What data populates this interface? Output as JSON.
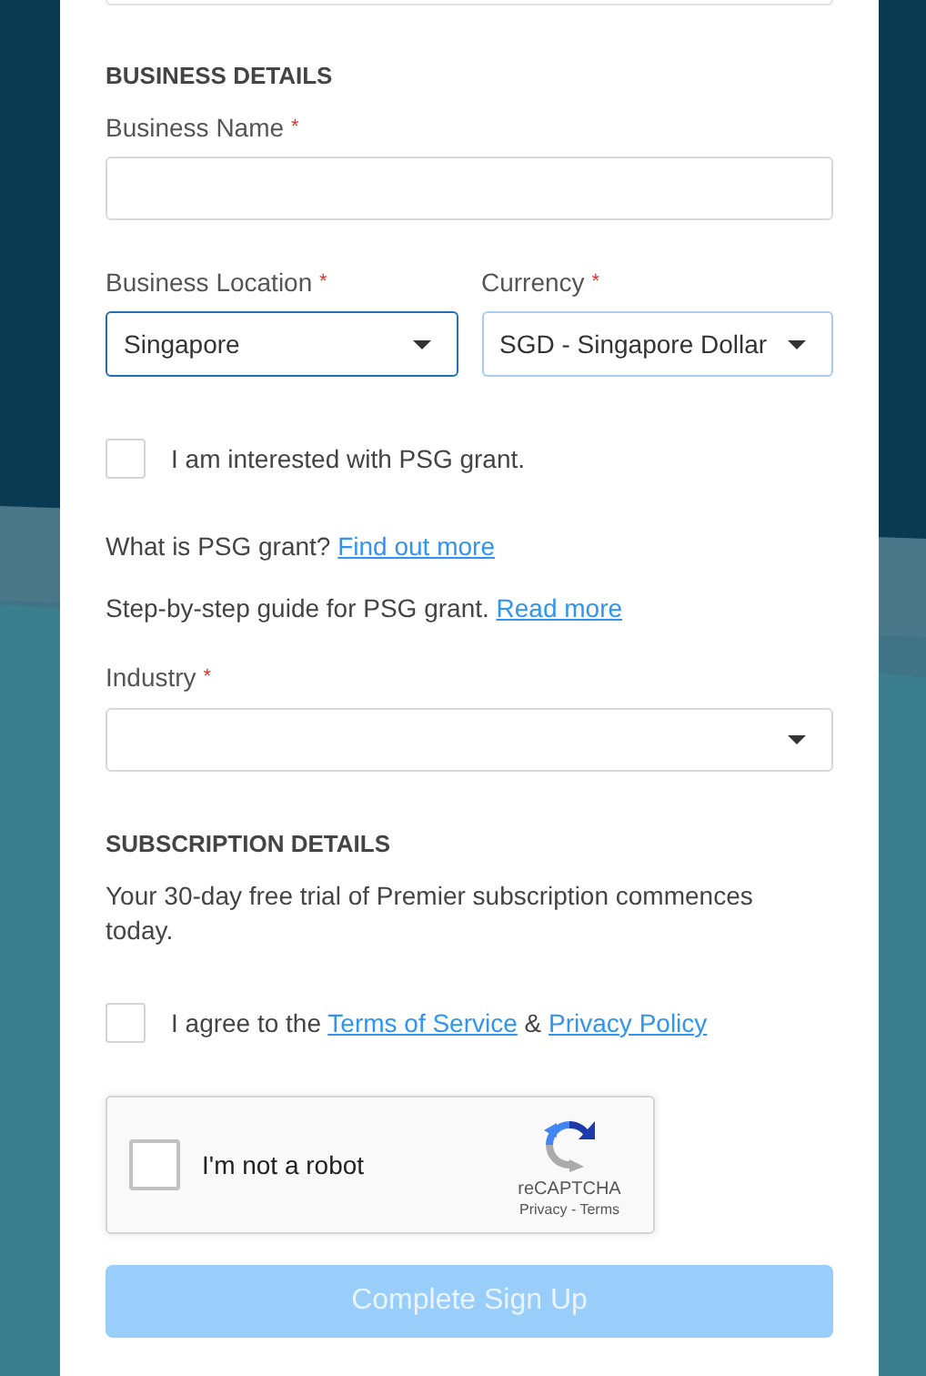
{
  "business_details": {
    "heading": "BUSINESS DETAILS",
    "business_name": {
      "label": "Business Name",
      "required_mark": "*"
    },
    "business_location": {
      "label": "Business Location",
      "required_mark": "*",
      "value": "Singapore",
      "focused": true
    },
    "currency": {
      "label": "Currency",
      "required_mark": "*",
      "value": "SGD - Singapore Dollar",
      "focused": false,
      "hovered": true
    },
    "psg_checkbox": {
      "label": "I am interested with PSG grant.",
      "checked": false
    },
    "info_lines": [
      {
        "parts": [
          {
            "kind": "text",
            "text": "What is PSG grant?"
          },
          {
            "kind": "link",
            "text": "Find out more"
          }
        ]
      },
      {
        "parts": [
          {
            "kind": "text",
            "text": "Step-by-step guide for PSG grant."
          },
          {
            "kind": "link",
            "text": "Read more"
          }
        ]
      }
    ],
    "industry": {
      "label": "Industry",
      "required_mark": "*",
      "focused": false
    }
  },
  "subscription_details": {
    "heading": "SUBSCRIPTION DETAILS",
    "message": "Your 30-day free trial of Premier subscription commences today.",
    "agree_checkbox": {
      "checked": false,
      "parts": [
        {
          "kind": "text",
          "text": "I agree to the"
        },
        {
          "kind": "link",
          "text": "Terms of Service"
        },
        {
          "kind": "text",
          "text": "&"
        },
        {
          "kind": "link",
          "text": "Privacy Policy"
        }
      ]
    }
  },
  "recaptcha": {
    "checked": false,
    "label": "I'm not a robot",
    "brand": "reCAPTCHA",
    "links": "Privacy - Terms"
  },
  "submit_button": {
    "label": "Complete Sign Up",
    "disabled": true
  }
}
